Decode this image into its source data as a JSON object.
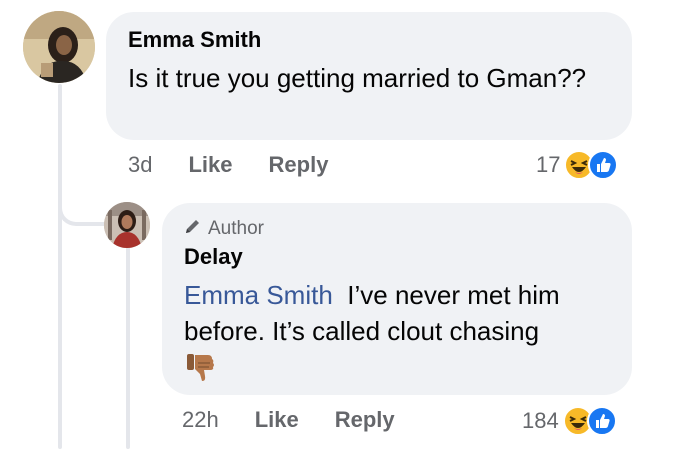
{
  "comment": {
    "author": "Emma Smith",
    "text": "Is it true you getting married to Gman??",
    "time": "3d",
    "like_label": "Like",
    "reply_label": "Reply",
    "reaction_count": "17",
    "reaction_icons": [
      "haha-reaction-icon",
      "like-reaction-icon"
    ]
  },
  "reply": {
    "badge": "Author",
    "author": "Delay",
    "mention": "Emma Smith",
    "text": "I’ve never met him before. It’s called clout chasing",
    "emoji": "thumbs-down-emoji",
    "time": "22h",
    "like_label": "Like",
    "reply_label": "Reply",
    "reaction_count": "184",
    "reaction_icons": [
      "haha-reaction-icon",
      "like-reaction-icon"
    ]
  },
  "colors": {
    "bubble": "#f0f2f5",
    "mention": "#385898",
    "meta": "#65676b",
    "like_blue": "#1877f2",
    "haha_yellow": "#f7b928"
  }
}
